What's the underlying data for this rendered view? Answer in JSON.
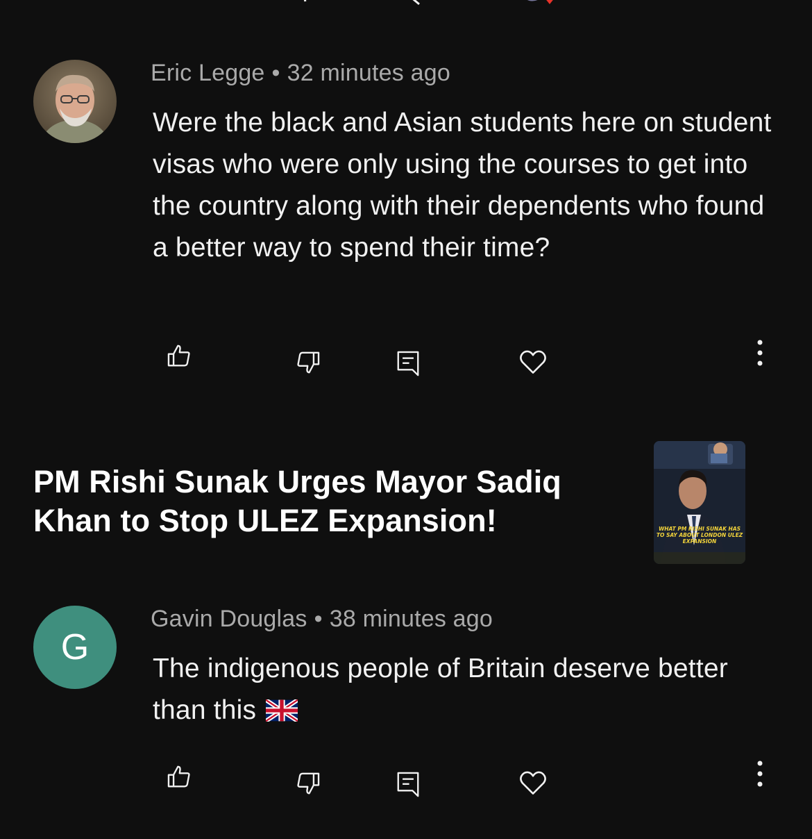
{
  "comments": [
    {
      "author": "Eric Legge",
      "separator": "•",
      "time": "32 minutes ago",
      "text": "Were the black and Asian students here on student visas who were only using the courses to get into the country along with their dependents who found a better way to spend their time?",
      "avatar": {
        "type": "photo"
      }
    },
    {
      "author": "Gavin Douglas",
      "separator": "•",
      "time": "38 minutes ago",
      "text": "The indigenous people of Britain deserve better than this",
      "emoji": "🇬🇧",
      "avatar": {
        "type": "letter",
        "letter": "G",
        "color": "#3f8f7e"
      }
    }
  ],
  "video_card": {
    "title": "PM Rishi Sunak Urges Mayor Sadiq Khan to Stop ULEZ Expansion!",
    "thumbnail_caption": "WHAT PM RISHI SUNAK HAS TO SAY ABOUT LONDON ULEZ EXPANSION"
  },
  "actions": {
    "icons": [
      "thumbs-up-icon",
      "thumbs-down-icon",
      "reply-icon",
      "heart-icon",
      "more-vertical-icon"
    ]
  },
  "colors": {
    "background": "#0f0f0f",
    "text_primary": "#f1f1f1",
    "text_secondary": "#aaaaaa",
    "thumbnail_caption": "#f2d33a"
  }
}
